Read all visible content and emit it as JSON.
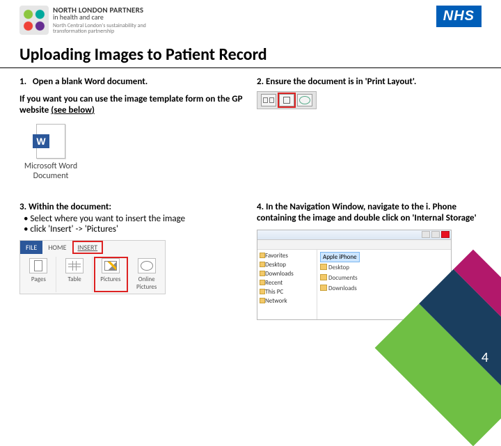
{
  "header": {
    "partner_line1": "NORTH LONDON PARTNERS",
    "partner_line2": "in health and care",
    "partner_line3": "North Central London's sustainability and transformation partnership",
    "nhs_badge": "NHS"
  },
  "title": "Uploading Images to Patient Record",
  "step1": {
    "num": "1.",
    "heading": "Open a blank Word document.",
    "sub_a": "If you want you can use the image template form on the GP website ",
    "sub_b": "(see below)",
    "doc_label_a": "Microsoft Word",
    "doc_label_b": "Document"
  },
  "step2": {
    "heading": "2. Ensure the document is in 'Print Layout'."
  },
  "step3": {
    "heading": "3. Within the document:",
    "b1": "Select where you want to insert the image",
    "b2": "click 'Insert' -> 'Pictures'",
    "ribbon": {
      "file": "FILE",
      "home": "HOME",
      "insert": "INSERT",
      "pages": "Pages",
      "table": "Table",
      "pictures": "Pictures",
      "online": "Online Pictures"
    }
  },
  "step4": {
    "heading": "4. In the Navigation Window, navigate to the i. Phone containing the image and double click on 'Internal Storage'",
    "sidebar": [
      "Favorites",
      "Desktop",
      "Downloads",
      "Recent",
      "This PC",
      "Network"
    ],
    "selected": "Apple iPhone",
    "rows": [
      "Desktop",
      "Documents",
      "Downloads"
    ]
  },
  "page_number": "4"
}
